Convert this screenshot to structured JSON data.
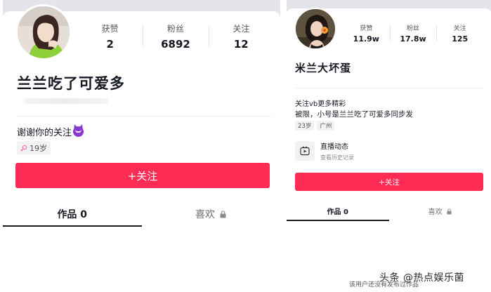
{
  "left_profile": {
    "stats": [
      {
        "label": "获赞",
        "value": "2"
      },
      {
        "label": "粉丝",
        "value": "6892"
      },
      {
        "label": "关注",
        "value": "12"
      }
    ],
    "name": "兰兰吃了可爱多",
    "bio": "谢谢你的关注",
    "age_tag": "19岁",
    "follow_button": "+关注",
    "tabs": {
      "works": "作品 0",
      "likes": "喜欢"
    }
  },
  "right_profile": {
    "stats": [
      {
        "label": "获赞",
        "value": "11.9w"
      },
      {
        "label": "粉丝",
        "value": "17.8w"
      },
      {
        "label": "关注",
        "value": "125"
      }
    ],
    "name": "米兰大坏蛋",
    "bio_line1": "关注vb更多精彩",
    "bio_line2": "被限，小号是兰兰吃了可爱多同步发",
    "tags": [
      "23岁",
      "广州"
    ],
    "live_title": "直播动态",
    "live_sub": "查看历史记录",
    "follow_button": "+关注",
    "tabs": {
      "works": "作品 0",
      "likes": "喜欢"
    }
  },
  "watermark": "头条 @热点娱乐菌",
  "footer_note": "该用户还没有发布过作品",
  "colors": {
    "accent": "#fe2c55",
    "text": "#161823",
    "muted": "#57585f"
  },
  "icons": [
    "avatar",
    "devil-emoji",
    "female-icon",
    "lock-icon",
    "live-replay-icon"
  ]
}
